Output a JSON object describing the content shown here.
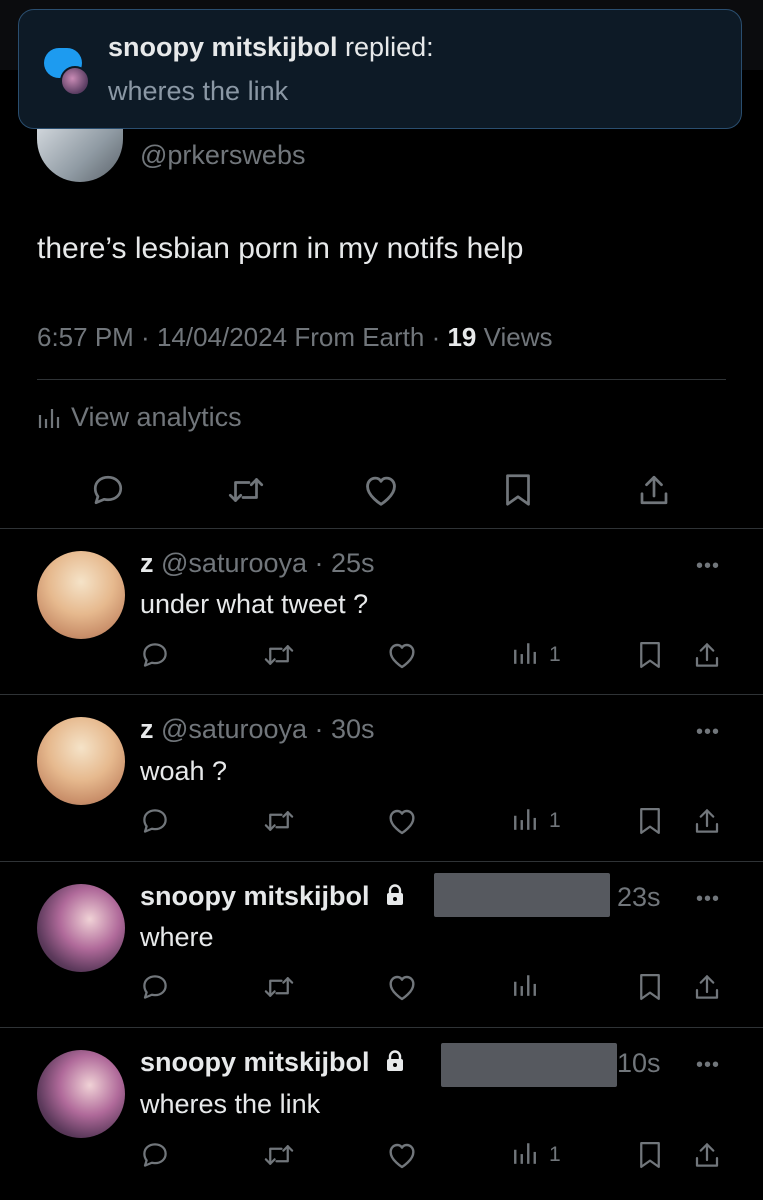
{
  "notification": {
    "user": "snoopy mitskijbol",
    "action": "replied:",
    "text": "wheres the link"
  },
  "tweet": {
    "handle": "@prkerswebs",
    "text": "there’s lesbian porn in my notifs help",
    "time": "6:57 PM",
    "date": "14/04/2024",
    "source": "From Earth",
    "views_count": "19",
    "views_label": "Views",
    "analytics_label": "View analytics"
  },
  "replies": [
    {
      "name": "z",
      "handle": "@saturooya",
      "time": "25s",
      "text": "under what tweet ?",
      "views": "1"
    },
    {
      "name": "z",
      "handle": "@saturooya",
      "time": "30s",
      "text": "woah ?",
      "views": "1"
    },
    {
      "name": "snoopy mitskijbol",
      "time": "23s",
      "text": "where",
      "views": ""
    },
    {
      "name": "snoopy mitskijbol",
      "time": "10s",
      "text": "wheres the link",
      "views": "1"
    }
  ],
  "colors": {
    "accent": "#1d9bf0",
    "muted": "#71767b",
    "text": "#e7e9ea",
    "background": "#000000"
  }
}
